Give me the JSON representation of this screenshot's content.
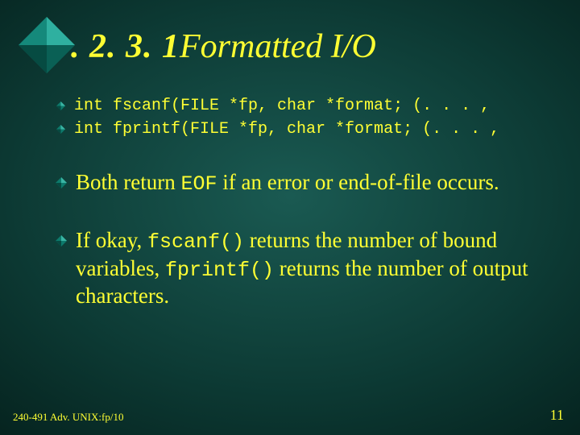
{
  "title": {
    "num": ". 2. 3. 1",
    "text": "Formatted I/O"
  },
  "signatures": [
    "int fscanf(FILE *fp, char *format; (. . . ,",
    "int fprintf(FILE *fp, char *format; (. . . ,"
  ],
  "paragraphs": {
    "p1_a": "Both return ",
    "p1_code": "EOF",
    "p1_b": " if an error or end-of-file occurs.",
    "p2_a": "If okay, ",
    "p2_code1": "fscanf()",
    "p2_b": " returns the number of bound variables, ",
    "p2_code2": "fprintf()",
    "p2_c": " returns the number of output characters."
  },
  "footer": {
    "left": "240-491 Adv. UNIX:fp/10",
    "right": "11"
  }
}
